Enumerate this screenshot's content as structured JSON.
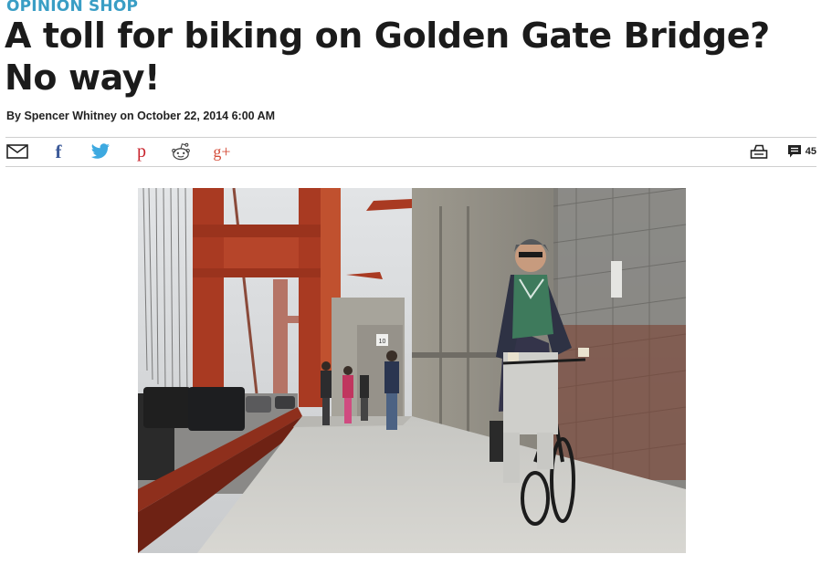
{
  "article": {
    "section": "OPINION SHOP",
    "headline": "A toll for biking on Golden Gate Bridge? No way!",
    "byline": "By Spencer Whitney on October 22, 2014 6:00 AM"
  },
  "share_bar": {
    "icons": [
      "email-icon",
      "facebook-icon",
      "twitter-icon",
      "pinterest-icon",
      "reddit-icon",
      "google-plus-icon",
      "print-icon",
      "comments-icon"
    ],
    "facebook_glyph": "f",
    "pinterest_glyph": "p",
    "gplus_glyph": "g+",
    "comment_count": "45"
  },
  "colors": {
    "section": "#3a9ec5",
    "twitter": "#3da9e0",
    "facebook": "#3b5998",
    "pinterest": "#c8232c",
    "google_plus": "#d44d3a",
    "bridge_orange": "#b13b22"
  },
  "photo": {
    "subject": "cyclist riding on Golden Gate Bridge sidewalk",
    "sign_text": "10"
  }
}
